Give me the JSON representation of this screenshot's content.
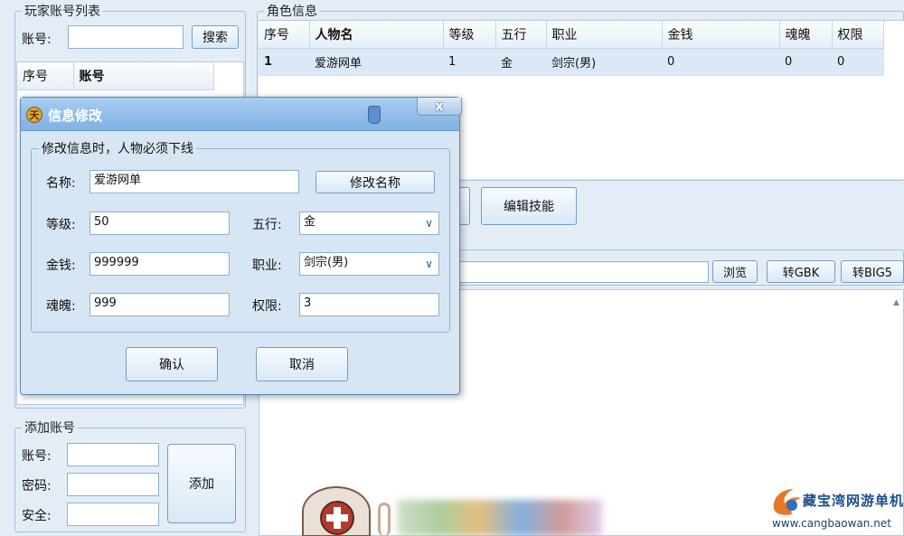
{
  "left_panel": {
    "title": "玩家账号列表",
    "account_label": "账号:",
    "account_value": "",
    "search_button": "搜索",
    "list_columns": [
      "序号",
      "账号"
    ]
  },
  "role_info": {
    "title": "角色信息",
    "columns": [
      "序号",
      "人物名",
      "等级",
      "五行",
      "职业",
      "金钱",
      "魂魄",
      "权限"
    ],
    "rows": [
      [
        "1",
        "爱游网单",
        "1",
        "金",
        "剑宗(男)",
        "0",
        "0",
        "0"
      ]
    ]
  },
  "edit_skill_button": "编辑技能",
  "file_bar": {
    "browse_button": "浏览",
    "gbk_button": "转GBK",
    "big5_button": "转BIG5"
  },
  "add_account": {
    "title": "添加账号",
    "account_label": "账号:",
    "password_label": "密码:",
    "security_label": "安全:",
    "add_button": "添加"
  },
  "dialog": {
    "title": "信息修改",
    "close_glyph": "x",
    "group_title": "修改信息时，人物必须下线",
    "name_label": "名称:",
    "name_value": "爱游网单",
    "rename_button": "修改名称",
    "level_label": "等级:",
    "level_value": "50",
    "element_label": "五行:",
    "element_value": "金",
    "money_label": "金钱:",
    "money_value": "999999",
    "job_label": "职业:",
    "job_value": "剑宗(男)",
    "soul_label": "魂魄:",
    "soul_value": "999",
    "perm_label": "权限:",
    "perm_value": "3",
    "ok_button": "确认",
    "cancel_button": "取消"
  },
  "watermark": {
    "name": "藏宝湾网游单机",
    "url": "www.cangbaowan.net"
  },
  "colors": {
    "background": "#e4edf6",
    "title_bar": "#7fb1e3",
    "selected_row": "#dbe9f7"
  }
}
